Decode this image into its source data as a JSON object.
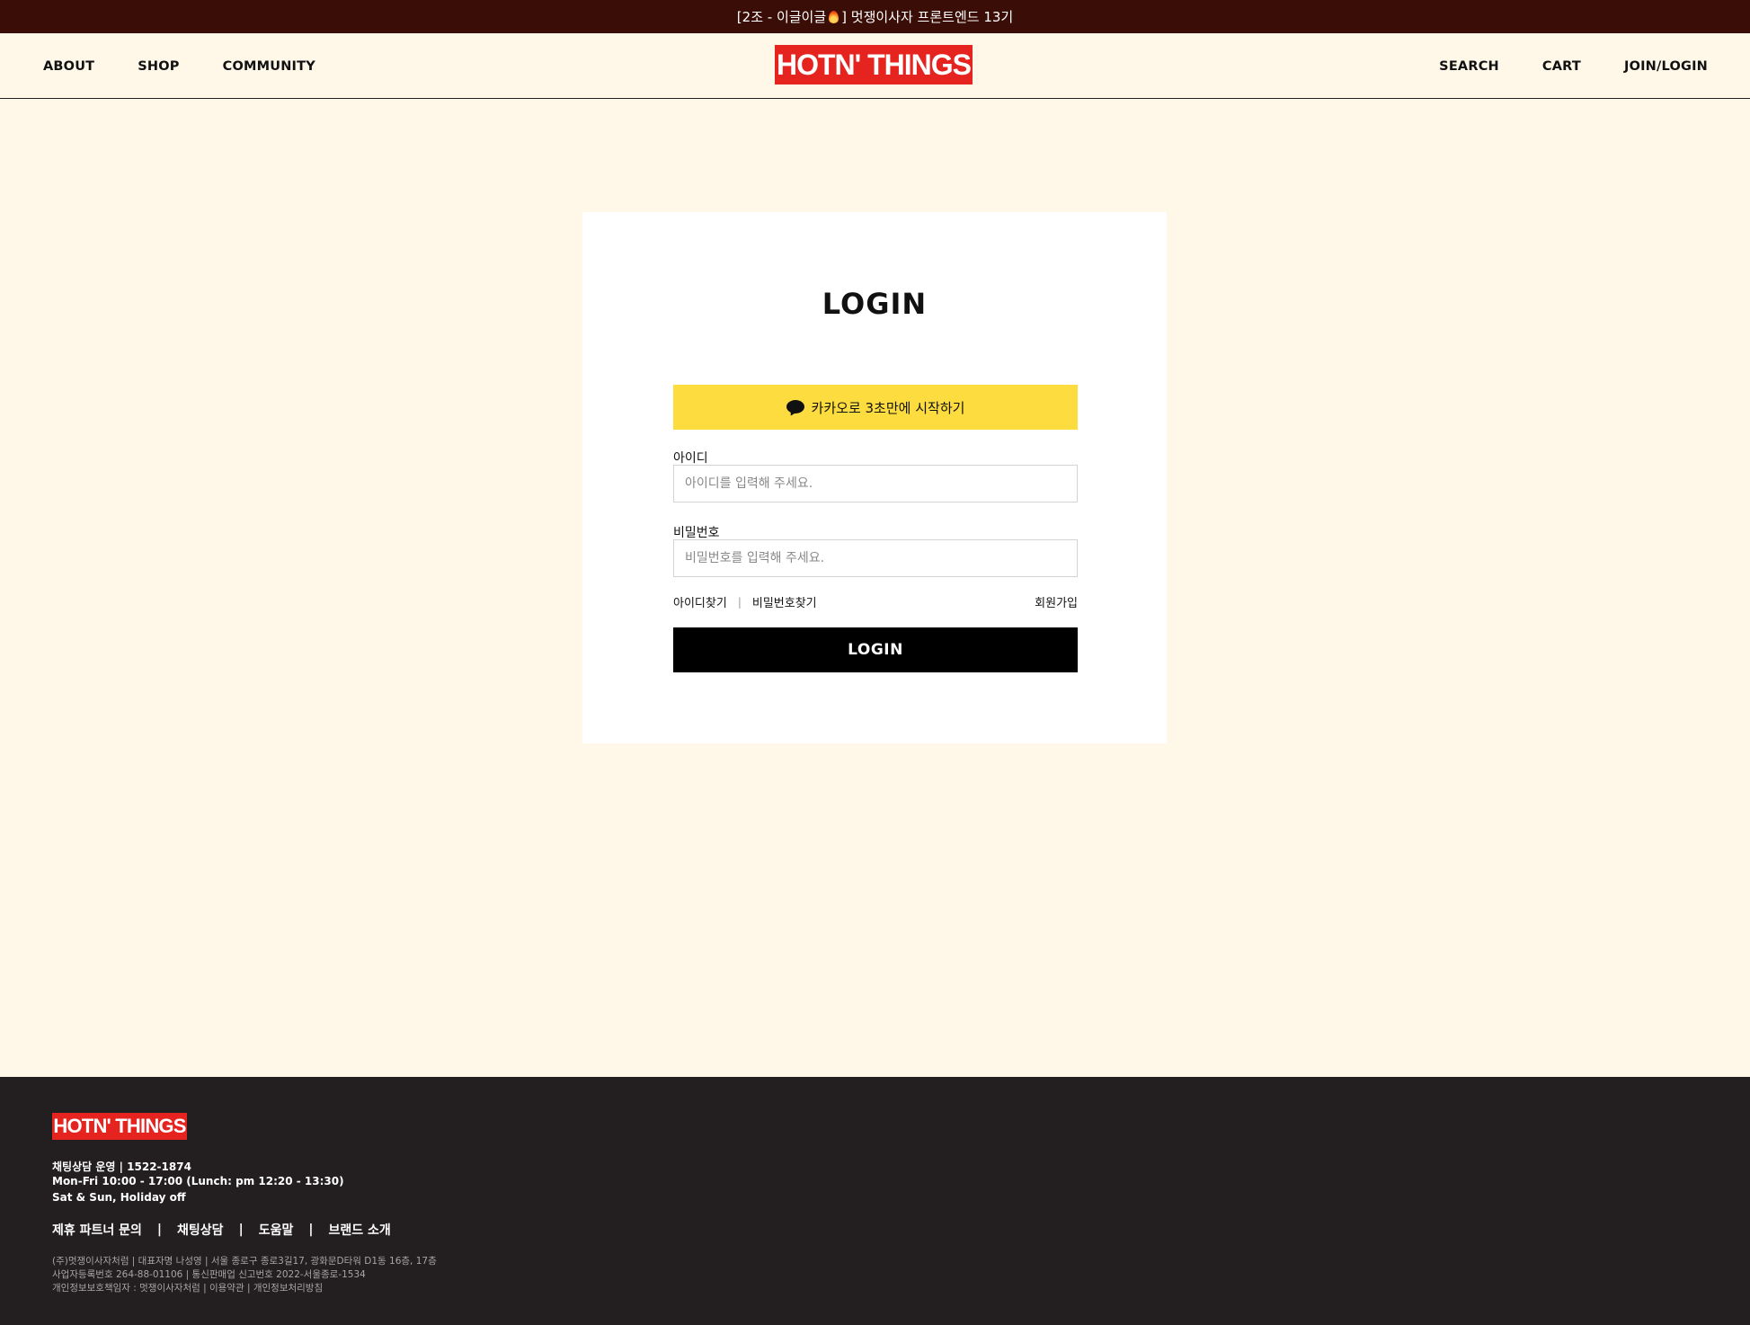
{
  "announcement": {
    "prefix": "[2조 - 이글이글",
    "suffix": "] 멋쟁이사자 프론트엔드 13기",
    "icon": "fire-icon"
  },
  "header": {
    "nav_left": [
      "ABOUT",
      "SHOP",
      "COMMUNITY"
    ],
    "logo": "HOTN' THINGS",
    "nav_right": [
      "SEARCH",
      "CART",
      "JOIN/LOGIN"
    ]
  },
  "login": {
    "title": "LOGIN",
    "kakao_label": "카카오로 3초만에 시작하기",
    "kakao_icon": "speech-bubble-icon",
    "id_label": "아이디",
    "id_placeholder": "아이디를 입력해 주세요.",
    "password_label": "비밀번호",
    "password_placeholder": "비밀번호를 입력해 주세요.",
    "find_id": "아이디찾기",
    "separator": "|",
    "find_password": "비밀번호찾기",
    "signup": "회원가입",
    "submit": "LOGIN"
  },
  "footer": {
    "logo": "HOTN' THINGS",
    "contact_line": "채팅상담 운영  |  1522-1874",
    "hours_line": "Mon-Fri 10:00 - 17:00 (Lunch: pm 12:20 - 13:30)",
    "holiday_line": "Sat & Sun, Holiday off",
    "links": [
      "제휴 파트너 문의",
      "채팅상담",
      "도움말",
      "브랜드 소개"
    ],
    "link_separator": "|",
    "legal_line1": "(주)멋쟁이사자처럼  |  대표자명 나성영  |  서울 종로구 종로3길17, 광화문D타워 D1동 16층, 17층",
    "legal_line2": "사업자등록번호 264-88-01106 | 통신판매업 신고번호 2022-서울종로-1534",
    "legal_line3": "개인정보보호책임자 : 멋쟁이사자처럼  |  이용약관  |  개인정보처리방침"
  },
  "colors": {
    "page_bg": "#fff8e9",
    "announcement_bg": "#3a0d06",
    "brand_red": "#e52420",
    "kakao_yellow": "#fddc3f",
    "button_black": "#000000",
    "footer_bg": "#231f20"
  }
}
